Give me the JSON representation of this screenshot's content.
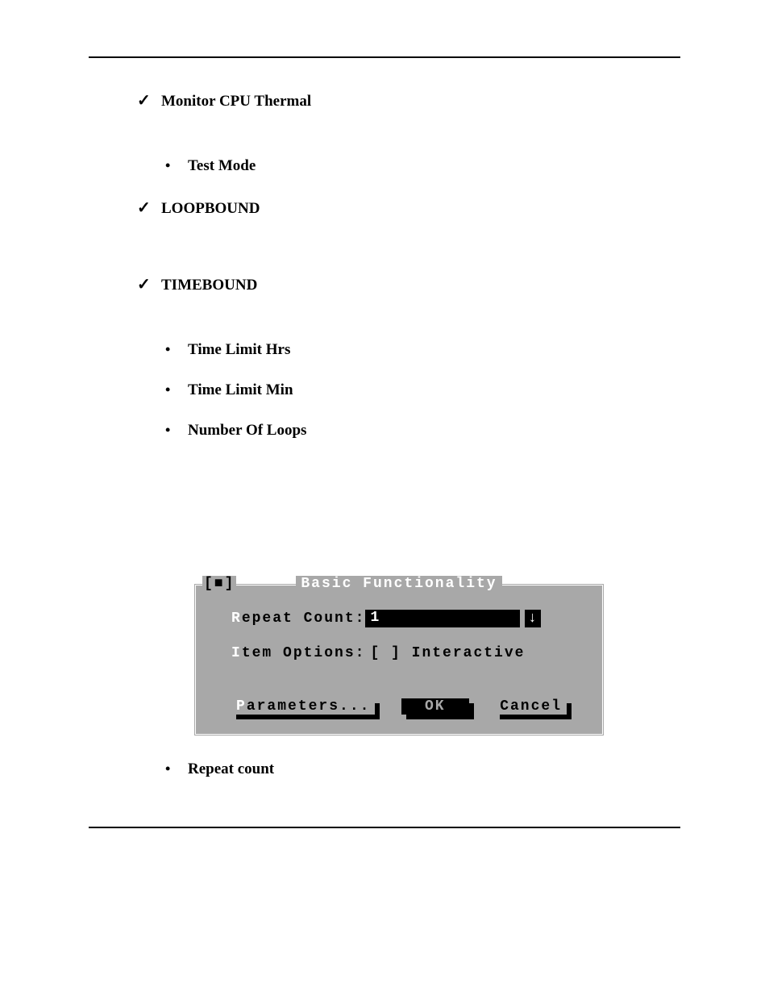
{
  "list": {
    "monitor_cpu_thermal": "Monitor CPU Thermal",
    "test_mode": "Test Mode",
    "loopbound": "LOOPBOUND",
    "timebound": "TIMEBOUND",
    "time_limit_hrs": "Time Limit Hrs",
    "time_limit_min": "Time Limit Min",
    "number_of_loops": "Number Of Loops",
    "repeat_count": "Repeat count"
  },
  "dialog": {
    "close_glyph": "[■]",
    "title": "Basic Functionality",
    "repeat_label_hot": "R",
    "repeat_label_rest": "epeat Count:",
    "repeat_value": "1",
    "dropdown_glyph": "↓",
    "item_options_hot": "I",
    "item_options_rest": "tem Options:",
    "interactive_box": "[ ] Interactive",
    "buttons": {
      "parameters_hot": "P",
      "parameters_rest": "arameters...",
      "ok": "OK",
      "cancel": "Cancel"
    }
  }
}
